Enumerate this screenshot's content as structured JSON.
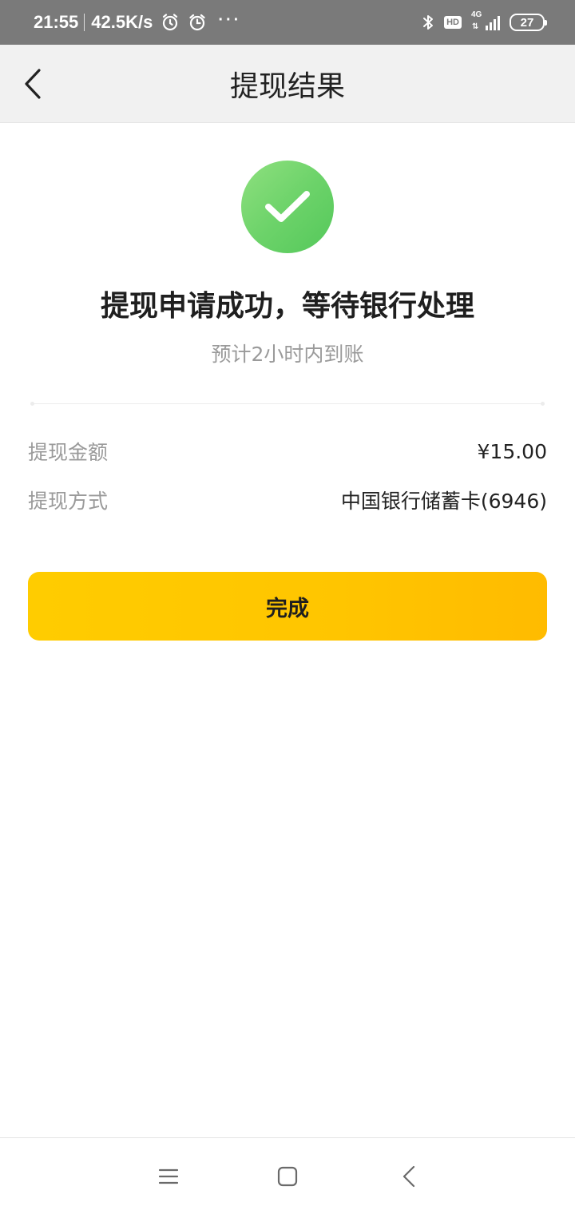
{
  "status_bar": {
    "time": "21:55",
    "net_speed": "42.5K/s",
    "overflow": "···",
    "hd": "HD",
    "network": "4G",
    "network_arrows": "⇅",
    "battery": "27"
  },
  "nav": {
    "title": "提现结果"
  },
  "result": {
    "title": "提现申请成功，等待银行处理",
    "subtitle": "预计2小时内到账"
  },
  "details": [
    {
      "label": "提现金额",
      "value": "¥15.00"
    },
    {
      "label": "提现方式",
      "value": "中国银行储蓄卡(6946)"
    }
  ],
  "actions": {
    "done_label": "完成"
  },
  "colors": {
    "status_bar": "#7a7a7a",
    "nav_bar": "#f1f1f1",
    "success_green": "#6dd36a",
    "button_yellow": "#ffc500"
  }
}
